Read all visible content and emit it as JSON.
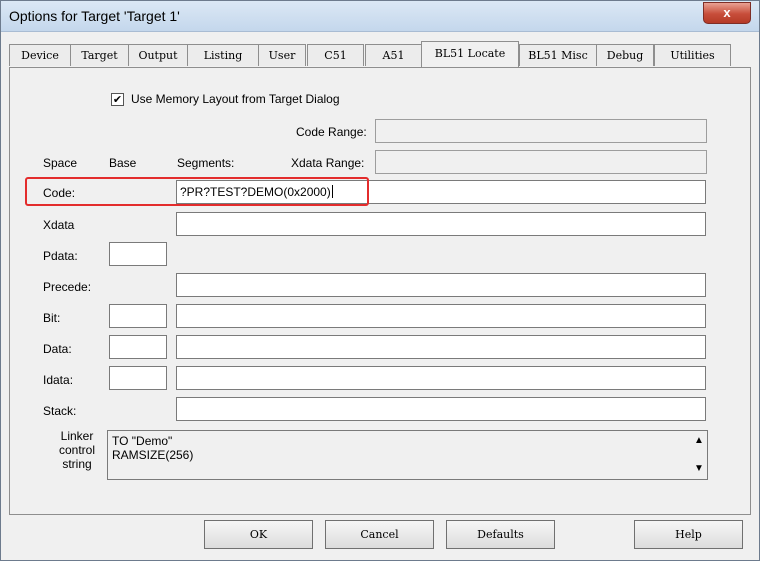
{
  "window": {
    "title": "Options for Target 'Target 1'",
    "close_glyph": "x"
  },
  "tabs": [
    {
      "label": "Device"
    },
    {
      "label": "Target"
    },
    {
      "label": "Output"
    },
    {
      "label": "Listing"
    },
    {
      "label": "User"
    },
    {
      "label": "C51"
    },
    {
      "label": "A51"
    },
    {
      "label": "BL51 Locate"
    },
    {
      "label": "BL51 Misc"
    },
    {
      "label": "Debug"
    },
    {
      "label": "Utilities"
    }
  ],
  "checkbox": {
    "label": "Use Memory Layout from Target Dialog",
    "checked_glyph": "✔"
  },
  "labels": {
    "code_range": "Code Range:",
    "xdata_range": "Xdata Range:",
    "space": "Space",
    "base": "Base",
    "segments": "Segments:"
  },
  "rows": {
    "code": {
      "label": "Code:",
      "segments": "?PR?TEST?DEMO(0x2000)"
    },
    "xdata": {
      "label": "Xdata",
      "segments": ""
    },
    "pdata": {
      "label": "Pdata:",
      "base": ""
    },
    "precede": {
      "label": "Precede:",
      "segments": ""
    },
    "bit": {
      "label": "Bit:",
      "base": "",
      "segments": ""
    },
    "data": {
      "label": "Data:",
      "base": "",
      "segments": ""
    },
    "idata": {
      "label": "Idata:",
      "base": "",
      "segments": ""
    },
    "stack": {
      "label": "Stack:",
      "segments": ""
    }
  },
  "linker": {
    "label_line1": "Linker",
    "label_line2": "control",
    "label_line3": "string",
    "line1": "TO \"Demo\"",
    "line2": "RAMSIZE(256)",
    "scroll_up": "▲",
    "scroll_down": "▼"
  },
  "buttons": {
    "ok": "OK",
    "cancel": "Cancel",
    "defaults": "Defaults",
    "help": "Help"
  },
  "colors": {
    "highlight": "#e32c2c",
    "close": "#c74d3a"
  }
}
